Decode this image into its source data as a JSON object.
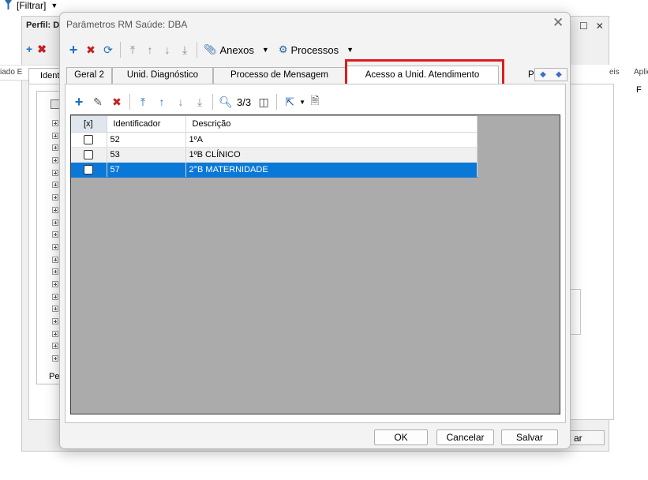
{
  "background": {
    "filter_label": "[Filtrar]",
    "window_title": "Perfil: D",
    "left_cut_text": "iado E",
    "right_col1": "eis",
    "right_col2": "Aplic",
    "right_value": "F",
    "tab_label": "Ident",
    "bottom_label": "Per",
    "button_label": "ar"
  },
  "dialog": {
    "title": "Parâmetros RM Saúde: DBA",
    "toolbar": {
      "anexos_label": "Anexos",
      "processos_label": "Processos"
    },
    "tabs": [
      {
        "label": "Geral 2"
      },
      {
        "label": "Unid. Diagnóstico"
      },
      {
        "label": "Processo de Mensagem"
      },
      {
        "label": "Acesso a Unid. Atendimento"
      },
      {
        "label": "P"
      }
    ],
    "panel_toolbar": {
      "record_count": "3/3"
    },
    "grid": {
      "headers": [
        "[x]",
        "Identificador",
        "Descrição"
      ],
      "rows": [
        {
          "id": "52",
          "descricao": "1ºA"
        },
        {
          "id": "53",
          "descricao": "1ºB CLÍNICO"
        },
        {
          "id": "57",
          "descricao": "2°B MATERNIDADE"
        }
      ]
    },
    "buttons": {
      "ok": "OK",
      "cancel": "Cancelar",
      "save": "Salvar"
    }
  },
  "colors": {
    "selection": "#0a78d7",
    "highlight_box": "#e01b1b",
    "grid_background": "#ababab"
  }
}
